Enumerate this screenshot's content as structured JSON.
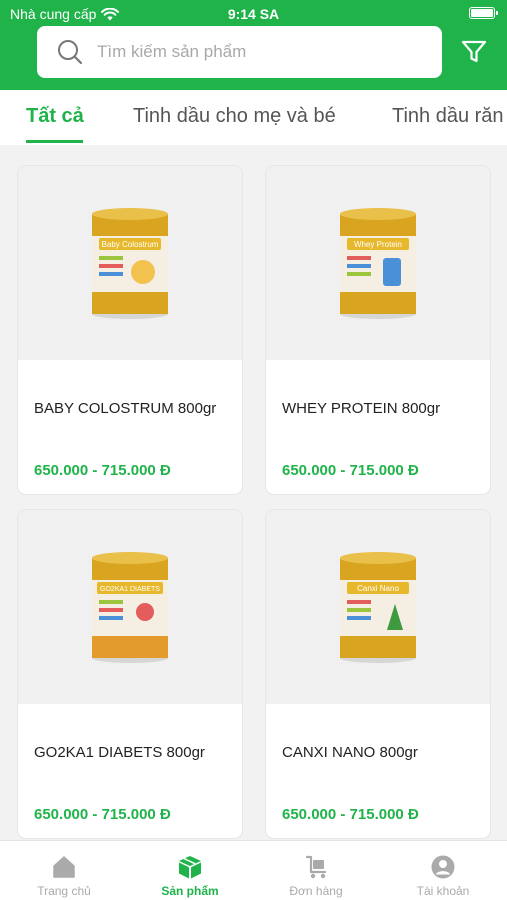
{
  "status_bar": {
    "carrier": "Nhà cung cấp",
    "time": "9:14 SA"
  },
  "search": {
    "placeholder": "Tìm kiếm sản phẩm"
  },
  "tabs": [
    {
      "label": "Tất cả",
      "active": true
    },
    {
      "label": "Tinh dầu cho mẹ và bé",
      "active": false
    },
    {
      "label": "Tinh dầu răn",
      "active": false
    }
  ],
  "products": [
    {
      "name": "BABY COLOSTRUM 800gr",
      "price": "650.000 - 715.000 Đ",
      "can_label": "Baby Colostrum",
      "icon": "milk-can-image"
    },
    {
      "name": "WHEY PROTEIN 800gr",
      "price": "650.000 - 715.000 Đ",
      "can_label": "Whey Protein",
      "icon": "milk-can-image"
    },
    {
      "name": "GO2KA1 DIABETS 800gr",
      "price": "650.000 - 715.000 Đ",
      "can_label": "GO2KA1 DIABETS",
      "icon": "milk-can-image"
    },
    {
      "name": "CANXI NANO 800gr",
      "price": "650.000 - 715.000 Đ",
      "can_label": "Canxi Nano",
      "icon": "milk-can-image"
    }
  ],
  "bottom_nav": [
    {
      "label": "Trang chủ",
      "icon": "home-icon",
      "active": false
    },
    {
      "label": "Sản phẩm",
      "icon": "box-icon",
      "active": true
    },
    {
      "label": "Đơn hàng",
      "icon": "cart-icon",
      "active": false
    },
    {
      "label": "Tài khoản",
      "icon": "user-icon",
      "active": false
    }
  ],
  "colors": {
    "brand_green": "#1fb34a",
    "inactive_gray": "#aaaaaa",
    "can_gold": "#d9a520"
  }
}
